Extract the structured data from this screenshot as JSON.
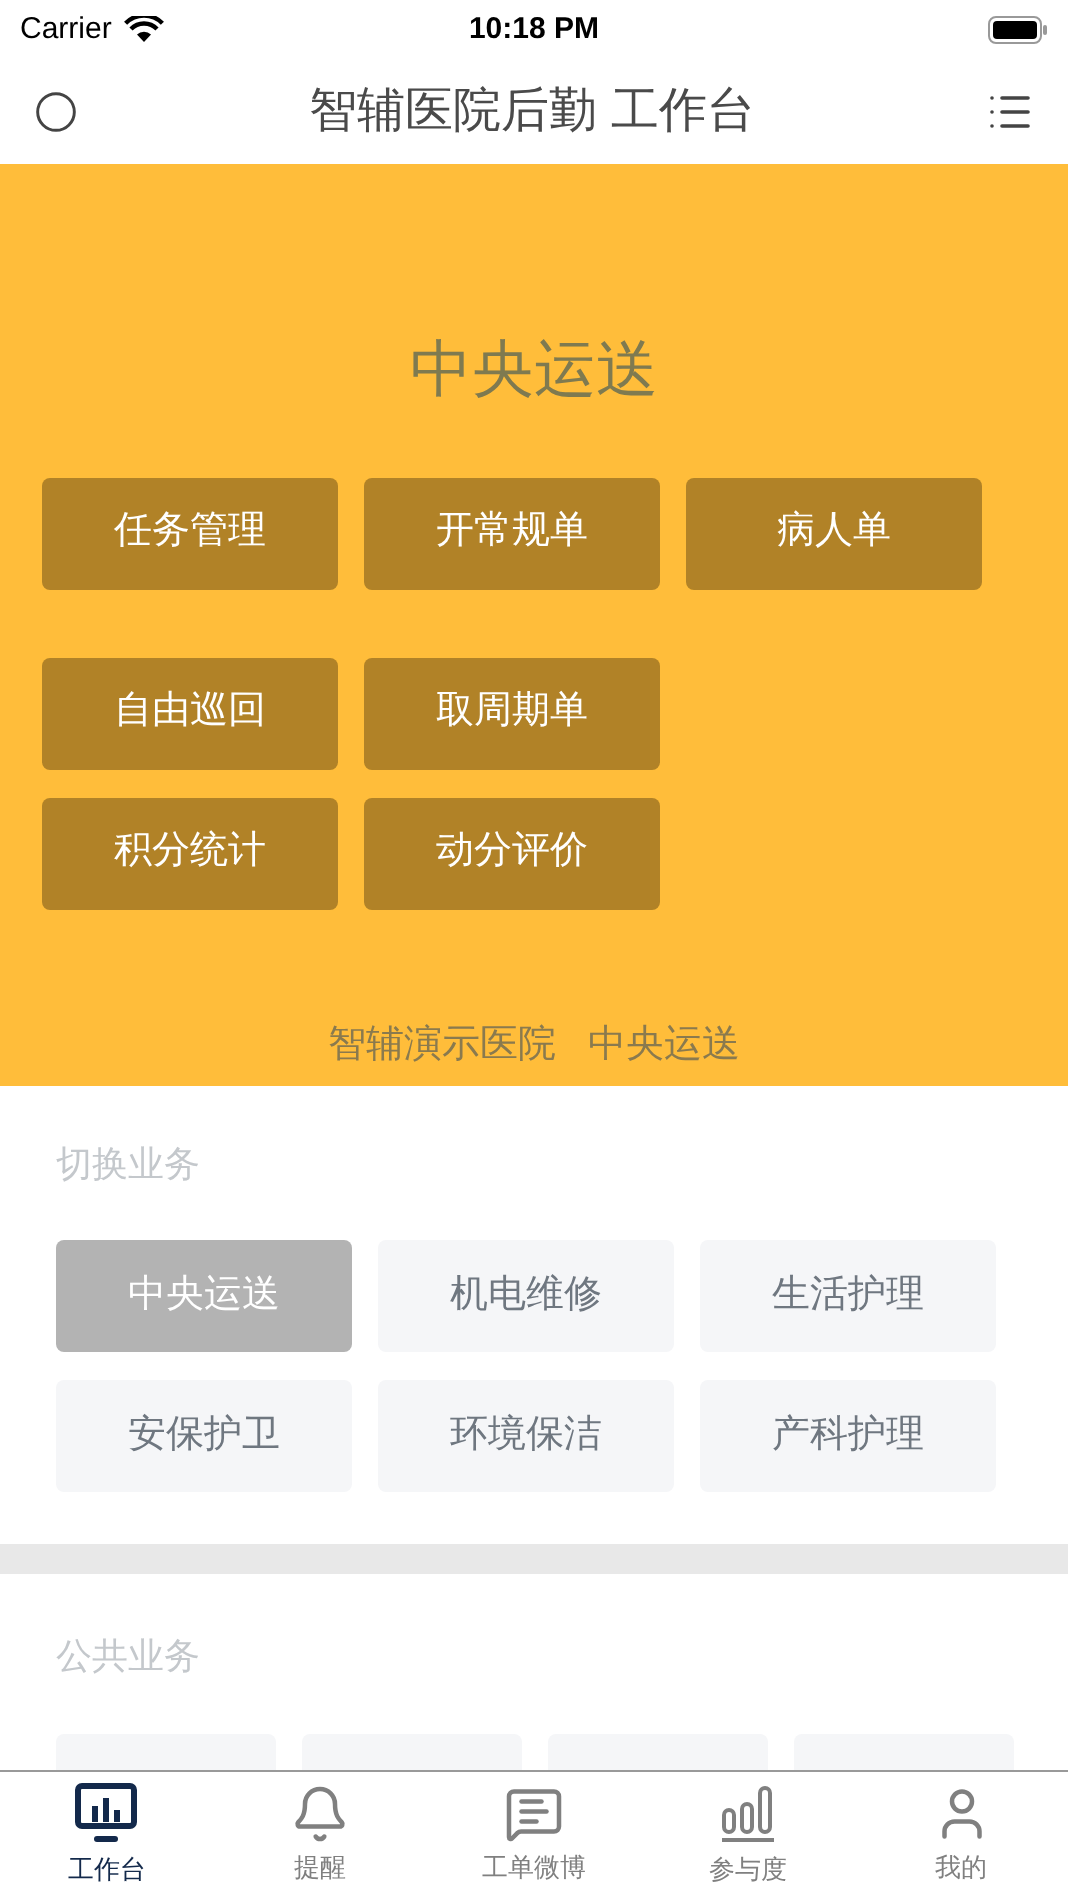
{
  "status_bar": {
    "carrier": "Carrier",
    "time": "10:18 PM"
  },
  "nav": {
    "title": "智辅医院后勤 工作台"
  },
  "banner": {
    "title": "中央运送",
    "action_rows": [
      [
        "任务管理",
        "开常规单",
        "病人单"
      ],
      [
        "自由巡回",
        "取周期单"
      ],
      [
        "积分统计",
        "动分评价"
      ]
    ],
    "footer": "智辅演示医院   中央运送"
  },
  "switch_section": {
    "heading": "切换业务",
    "items": [
      {
        "label": "中央运送",
        "selected": true
      },
      {
        "label": "机电维修",
        "selected": false
      },
      {
        "label": "生活护理",
        "selected": false
      },
      {
        "label": "安保护卫",
        "selected": false
      },
      {
        "label": "环境保洁",
        "selected": false
      },
      {
        "label": "产科护理",
        "selected": false
      }
    ]
  },
  "public_section": {
    "heading": "公共业务"
  },
  "tab_bar": [
    {
      "label": "工作台",
      "selected": true
    },
    {
      "label": "提醒",
      "selected": false
    },
    {
      "label": "工单微博",
      "selected": false
    },
    {
      "label": "参与度",
      "selected": false
    },
    {
      "label": "我的",
      "selected": false
    }
  ]
}
